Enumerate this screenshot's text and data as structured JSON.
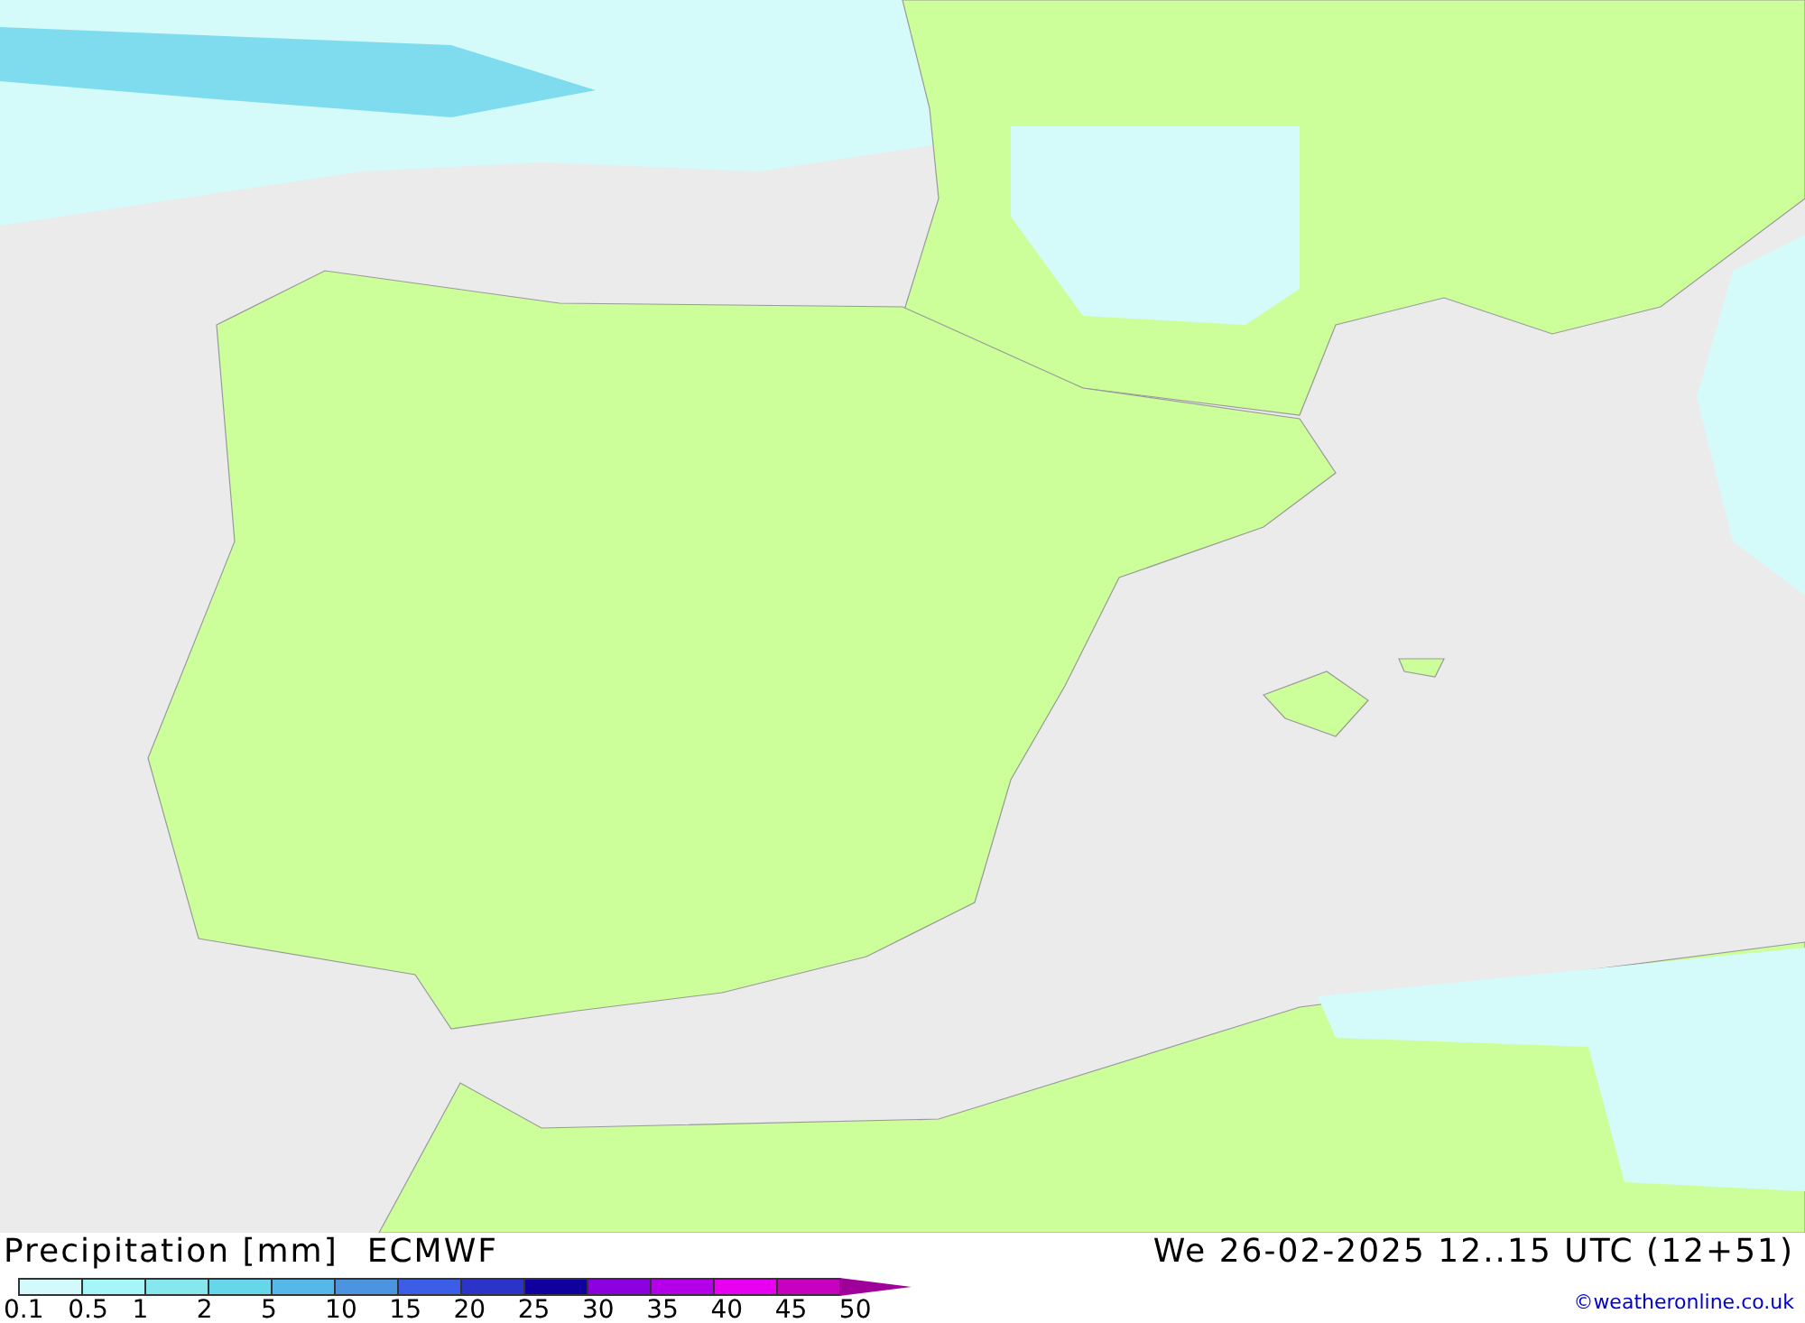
{
  "legend": {
    "title": "Precipitation [mm]",
    "model": "ECMWF",
    "segments": [
      {
        "color": "#d2fafa"
      },
      {
        "color": "#a6f5f8"
      },
      {
        "color": "#86e8ee"
      },
      {
        "color": "#66d6ea"
      },
      {
        "color": "#56b8e8"
      },
      {
        "color": "#4d94e0"
      },
      {
        "color": "#3c5ee6"
      },
      {
        "color": "#2a34c8"
      },
      {
        "color": "#10009e"
      },
      {
        "color": "#8c00e0"
      },
      {
        "color": "#b400e8"
      },
      {
        "color": "#e800f0"
      },
      {
        "color": "#c800c0"
      }
    ],
    "labels": [
      "0.1",
      "0.5",
      "1",
      "2",
      "5",
      "10",
      "15",
      "20",
      "25",
      "30",
      "35",
      "40",
      "45",
      "50"
    ]
  },
  "valid_time": "We 26-02-2025 12..15 UTC (12+51)",
  "credit": "©weatheronline.co.uk"
}
